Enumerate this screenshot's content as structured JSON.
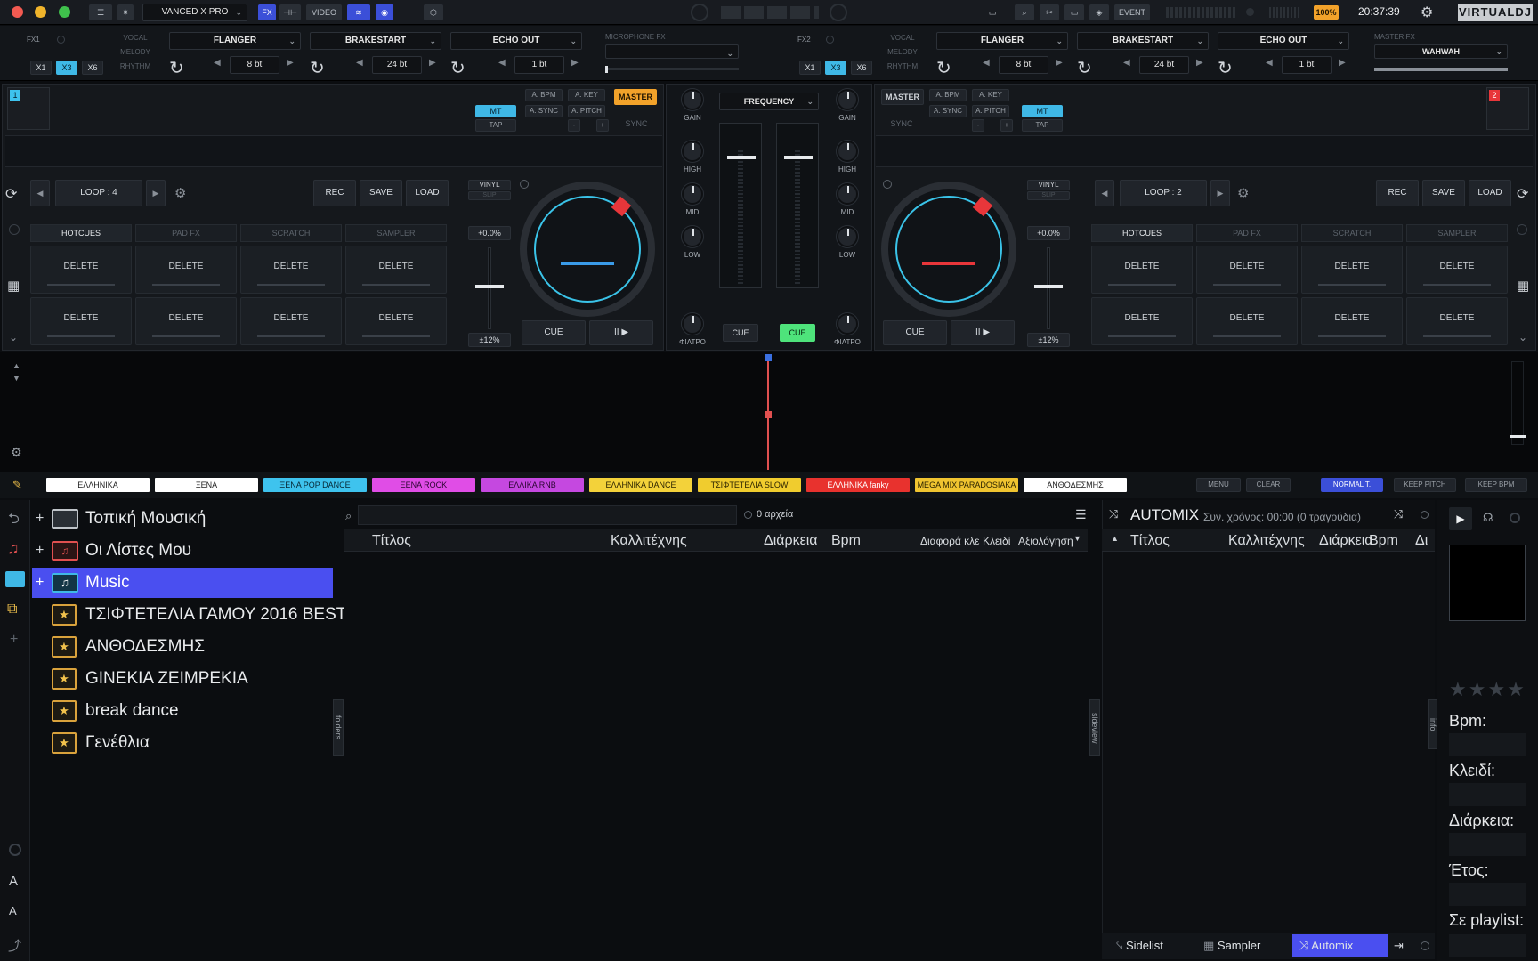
{
  "topbar": {
    "skin_name": "VANCED X PRO",
    "buttons": [
      "FX",
      "VIDEO",
      "EVENT"
    ],
    "battery": "100%",
    "clock": "20:37:39",
    "brand": "VIRTUALDJ"
  },
  "fx": {
    "left": {
      "label": "FX1",
      "modes": [
        "VOCAL",
        "MELODY",
        "RHYTHM"
      ],
      "mult": [
        "X1",
        "X3",
        "X6"
      ],
      "slots": [
        {
          "name": "FLANGER",
          "beats": "8 bt"
        },
        {
          "name": "BRAKESTART",
          "beats": "24 bt"
        },
        {
          "name": "ECHO OUT",
          "beats": "1 bt"
        }
      ],
      "mic_label": "MICROPHONE FX"
    },
    "right": {
      "label": "FX2",
      "modes": [
        "VOCAL",
        "MELODY",
        "RHYTHM"
      ],
      "mult": [
        "X1",
        "X3",
        "X6"
      ],
      "slots": [
        {
          "name": "FLANGER",
          "beats": "8 bt"
        },
        {
          "name": "BRAKESTART",
          "beats": "24 bt"
        },
        {
          "name": "ECHO OUT",
          "beats": "1 bt"
        }
      ],
      "master_label": "MASTER FX",
      "master_value": "WAHWAH"
    }
  },
  "deck1": {
    "number": "1",
    "btn_mt": "MT",
    "btn_tap": "TAP",
    "btn_abpm": "A. BPM",
    "btn_akey": "A. KEY",
    "btn_async": "A. SYNC",
    "btn_apitch": "A. PITCH",
    "btn_master": "MASTER",
    "btn_sync": "SYNC",
    "btn_minus": "-",
    "btn_plus": "+",
    "loop": "LOOP : 4",
    "rec": "REC",
    "save": "SAVE",
    "load": "LOAD",
    "vinyl": "VINYL",
    "slip": "SLIP",
    "pitch": "+0.0%",
    "range": "±12%",
    "tabs": [
      "HOTCUES",
      "PAD FX",
      "SCRATCH",
      "SAMPLER"
    ],
    "pads": [
      "DELETE",
      "DELETE",
      "DELETE",
      "DELETE",
      "DELETE",
      "DELETE",
      "DELETE",
      "DELETE"
    ],
    "cue": "CUE",
    "play": "II ▶"
  },
  "deck2": {
    "number": "2",
    "btn_mt": "MT",
    "btn_tap": "TAP",
    "btn_abpm": "A. BPM",
    "btn_akey": "A. KEY",
    "btn_async": "A. SYNC",
    "btn_apitch": "A. PITCH",
    "btn_master": "MASTER",
    "btn_sync": "SYNC",
    "btn_minus": "-",
    "btn_plus": "+",
    "loop": "LOOP : 2",
    "rec": "REC",
    "save": "SAVE",
    "load": "LOAD",
    "vinyl": "VINYL",
    "slip": "SLIP",
    "pitch": "+0.0%",
    "range": "±12%",
    "tabs": [
      "HOTCUES",
      "PAD FX",
      "SCRATCH",
      "SAMPLER"
    ],
    "pads": [
      "DELETE",
      "DELETE",
      "DELETE",
      "DELETE",
      "DELETE",
      "DELETE",
      "DELETE",
      "DELETE"
    ],
    "cue": "CUE",
    "play": "II ▶"
  },
  "mixer": {
    "frequency": "FREQUENCY",
    "gain": "GAIN",
    "high": "HIGH",
    "mid": "MID",
    "low": "LOW",
    "filter": "ΦΙΛΤΡΟ",
    "cue_left": "CUE",
    "cue_right": "CUE"
  },
  "color_tags": [
    {
      "label": "ΕΛΛΗΝΙΚΑ",
      "bg": "#ffffff",
      "fg": "#222222"
    },
    {
      "label": "ΞΕΝΑ",
      "bg": "#ffffff",
      "fg": "#222222"
    },
    {
      "label": "ΞΕΝΑ POP DANCE",
      "bg": "#3ec3ee",
      "fg": "#072734"
    },
    {
      "label": "ΞΕΝΑ ROCK",
      "bg": "#e04de6",
      "fg": "#2a0530"
    },
    {
      "label": "ΕΛΛΙΚΑ RNB",
      "bg": "#c548e0",
      "fg": "#2a0530"
    },
    {
      "label": "ΕΛΛΗΝΙΚΑ DANCE",
      "bg": "#f3d23a",
      "fg": "#2b2300"
    },
    {
      "label": "ΤΣΙΦΤΕΤΕΛΙΑ SLOW",
      "bg": "#f0cc2e",
      "fg": "#2b2300"
    },
    {
      "label": "ΕΛΛΗΝΙΚΑ fanky",
      "bg": "#e8322e",
      "fg": "#ffffff"
    },
    {
      "label": "MEGA MIX PARADOSIAKA",
      "bg": "#f0c430",
      "fg": "#2b2300"
    },
    {
      "label": "ΑΝΘΟΔΕΣΜΗΣ",
      "bg": "#ffffff",
      "fg": "#222222"
    }
  ],
  "right_tools": {
    "menu": "MENU",
    "clear": "CLEAR",
    "normal": "NORMAL T.",
    "keep_pitch": "KEEP PITCH",
    "keep_bpm": "KEEP BPM"
  },
  "browser": {
    "tree": [
      {
        "label": "Τοπική Μουσική",
        "icon": "computer-icon"
      },
      {
        "label": "Οι Λίστες Μου",
        "icon": "playlist-icon"
      },
      {
        "label": "Music",
        "icon": "music-note-icon"
      },
      {
        "label": "ΤΣΙΦΤΕΤΕΛΙΑ ΓΑΜΟΥ 2016 BEST",
        "icon": "star-folder-icon"
      },
      {
        "label": "ΑΝΘΟΔΕΣΜΗΣ",
        "icon": "star-folder-icon"
      },
      {
        "label": "GINEKIA ZEIMPEKIA",
        "icon": "star-folder-icon"
      },
      {
        "label": "break dance",
        "icon": "star-folder-icon"
      },
      {
        "label": "Γενέθλια",
        "icon": "star-folder-icon"
      }
    ],
    "folders_tab": "folders",
    "sideview_tab": "sideview",
    "info_tab": "info",
    "search_placeholder": "",
    "file_count": "0 αρχεία",
    "columns": [
      "Τίτλος",
      "Καλλιτέχνης",
      "Διάρκεια",
      "Bpm",
      "Διαφορά κλε",
      "Κλειδί",
      "Αξιολόγηση"
    ]
  },
  "automix": {
    "title": "AUTOMIX",
    "summary": "Συν. χρόνος: 00:00 (0 τραγούδια)",
    "columns": [
      "Τίτλος",
      "Καλλιτέχνης",
      "Διάρκεια",
      "Bpm",
      "Δι"
    ],
    "tabs": [
      "Sidelist",
      "Sampler",
      "Automix"
    ]
  },
  "info": {
    "labels": [
      "Bpm:",
      "Κλειδί:",
      "Διάρκεια:",
      "Έτος:",
      "Σε playlist:"
    ]
  }
}
